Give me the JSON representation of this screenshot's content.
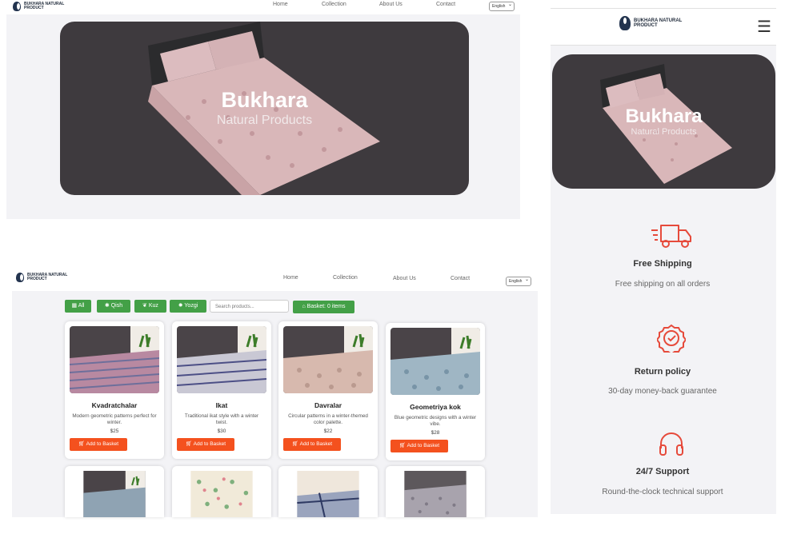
{
  "brand": {
    "line1": "BUKHARA NATURAL",
    "line2": "PRODUCT"
  },
  "nav": {
    "home": "Home",
    "collection": "Collection",
    "about": "About Us",
    "contact": "Contact"
  },
  "language": {
    "selected": "English"
  },
  "hero": {
    "title": "Bukhara",
    "subtitle": "Natural Products"
  },
  "filters": [
    {
      "label": "All",
      "icon": "grid-icon"
    },
    {
      "label": "Qish",
      "icon": "snowflake-icon"
    },
    {
      "label": "Kuz",
      "icon": "leaf-icon"
    },
    {
      "label": "Yozgi",
      "icon": "sun-icon"
    }
  ],
  "search": {
    "placeholder": "Search products..."
  },
  "basket": {
    "label": "Basket: 0 items"
  },
  "products": [
    {
      "name": "Kvadratchalar",
      "description": "Modern geometric patterns perfect for winter.",
      "price": "$25",
      "button": "Add to Basket"
    },
    {
      "name": "Ikat",
      "description": "Traditional ikat style with a winter twist.",
      "price": "$30",
      "button": "Add to Basket"
    },
    {
      "name": "Davralar",
      "description": "Circular patterns in a winter-themed color palette.",
      "price": "$22",
      "button": "Add to Basket"
    },
    {
      "name": "Geometriya kok",
      "description": "Blue geometric designs with a winter vibe.",
      "price": "$28",
      "button": "Add to Basket"
    }
  ],
  "features": [
    {
      "title": "Free Shipping",
      "subtitle": "Free shipping on all orders",
      "icon": "truck-icon"
    },
    {
      "title": "Return policy",
      "subtitle": "30-day money-back guarantee",
      "icon": "badge-check-icon"
    },
    {
      "title": "24/7 Support",
      "subtitle": "Round-the-clock technical support",
      "icon": "headphones-icon"
    }
  ],
  "colors": {
    "green": "#43a047",
    "orange": "#f4511e",
    "hero_bg": "#3e3a3e",
    "accent_red": "#e64a3b"
  }
}
